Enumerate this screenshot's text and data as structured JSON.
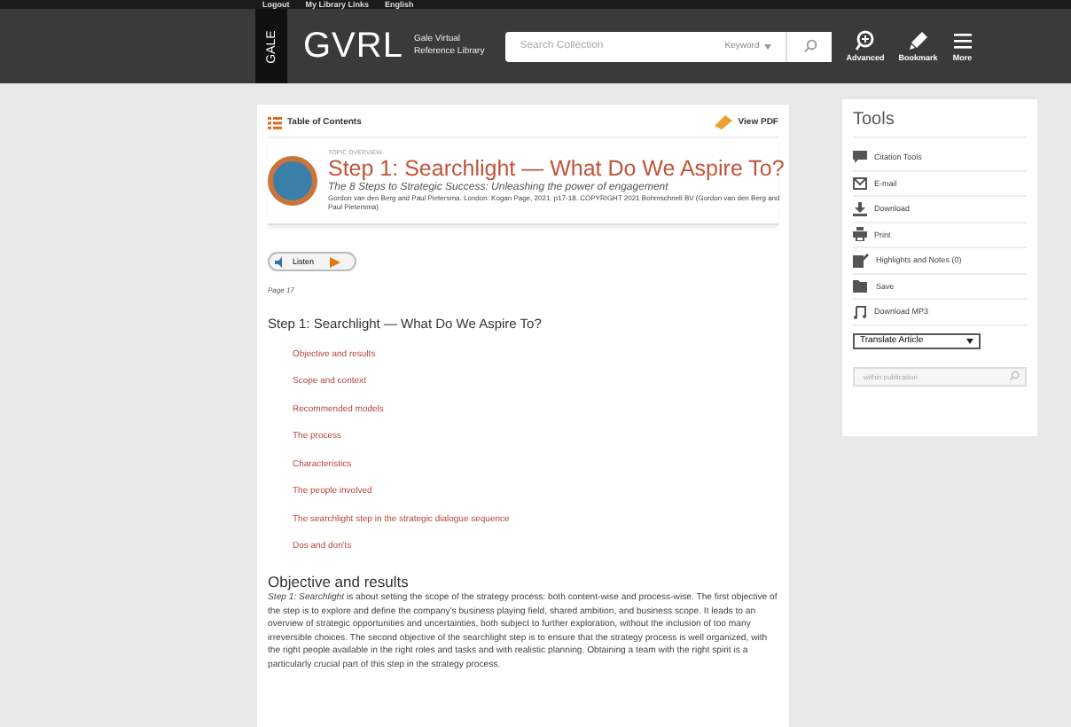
{
  "top_links": [
    "Logout",
    "My Library Links",
    "English"
  ],
  "header": {
    "brand_badge": "GALE",
    "brand": "GVRL",
    "brand_sub": [
      "Gale Virtual",
      "Reference Library"
    ],
    "search": {
      "placeholder": "Search Collection",
      "scope": "Keyword"
    },
    "actions": [
      {
        "label": "Advanced",
        "kind": "advanced"
      },
      {
        "label": "Bookmark",
        "kind": "bookmark"
      },
      {
        "label": "More",
        "kind": "more"
      }
    ]
  },
  "article": {
    "toc_label": "Table of Contents",
    "pdf_label": "View PDF",
    "section_label": "TOPIC OVERVIEW",
    "title": "Step 1: Searchlight — What Do We Aspire To?",
    "subtitle": "The 8 Steps to Strategic Success: Unleashing the power of engagement",
    "citation": "Gordon van den Berg and Paul Pietersma. London: Kogan Page, 2021. p17-18. COPYRIGHT 2021 Bohmschnell BV (Gordon van den Berg and Paul Pietersma)",
    "listen": "Listen",
    "page": "Page 17",
    "heading": "Step 1: Searchlight — What Do We Aspire To?",
    "links": [
      "Objective and results",
      "Scope and context",
      "Recommended models",
      "The process",
      "Characteristics",
      "The people involved",
      "The searchlight step in the strategic dialogue sequence",
      "Dos and don'ts"
    ],
    "section_heading": "Objective and results",
    "paragraph": "*Step 1: Searchlight* is about setting the scope of the strategy process: both content-wise and process-wise. The first objective of the step is to explore and define the company's business playing field, shared ambition, and business scope. It leads to an overview of strategic opportunities and uncertainties, both subject to further exploration, without the inclusion of too many irreversible choices. The second objective of the searchlight step is to ensure that the strategy process is well organized, with the right people available in the right roles and tasks and with realistic planning. Obtaining a team with the right spirit is a particularly crucial part of this step in the strategy process."
  },
  "tools": {
    "title": "Tools",
    "items": [
      {
        "label": "Citation Tools",
        "kind": "citation"
      },
      {
        "label": "E-mail",
        "kind": "email"
      },
      {
        "label": "Download",
        "kind": "download"
      },
      {
        "label": "Print",
        "kind": "print"
      },
      {
        "label": "Highlights and Notes (0)",
        "kind": "notes"
      },
      {
        "label": "Save",
        "kind": "save"
      },
      {
        "label": "Download MP3",
        "kind": "mp3"
      }
    ],
    "translate": "Translate Article",
    "search_placeholder": "within publication"
  }
}
